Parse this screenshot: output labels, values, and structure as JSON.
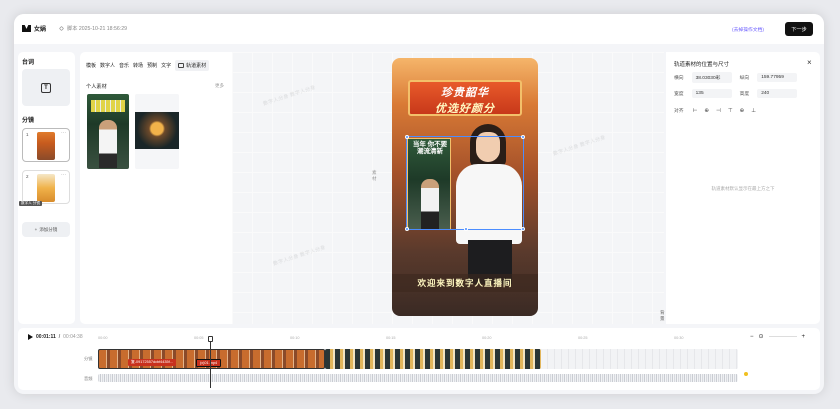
{
  "header": {
    "app_name": "女娲",
    "script_label": "脚本 2025-10-21 18:56:29",
    "help_link": "(去掉操作文档)",
    "next_button": "下一步"
  },
  "left_panel": {
    "title_lines": "台词",
    "title_scenes": "分镜",
    "text_icon_glyph": "T",
    "scenes": [
      {
        "num": "1",
        "more": "···"
      },
      {
        "num": "2",
        "more": "···",
        "tag": "数字人 分镜"
      }
    ],
    "add_scene": "添加分镜"
  },
  "materials": {
    "tabs": [
      "模板",
      "数字人",
      "音乐",
      "转场",
      "预制",
      "文字"
    ],
    "track_tab": "轨道素材",
    "personal_title": "个人素材",
    "more": "更多",
    "mat1_text": "当年 你不要"
  },
  "canvas": {
    "banner_line1": "珍贵韶华",
    "banner_line2": "优选好颜分",
    "inset_text": "当年 你不要 潮流清新",
    "caption": "欢迎来到数字人直播间",
    "bg_toggle": "背景",
    "side_label": "素材",
    "watermarks": [
      "数字人分身 数字人分身",
      "数字人分身 数字人分身",
      "数字人分身 数字人分身"
    ]
  },
  "properties": {
    "title": "轨道素材的位置与尺寸",
    "fields": {
      "x_label": "横向",
      "x_value": "38.03030彩",
      "y_label": "纵向",
      "y_value": "159.77959",
      "w_label": "宽度",
      "w_value": "135",
      "h_label": "高度",
      "h_value": "240",
      "align_label": "对齐"
    },
    "empty_text": "轨道素材默认显示在最上方之下"
  },
  "timeline": {
    "current_time": "00:01:11",
    "total_time": "00:04:38",
    "ruler_ticks": [
      "00:00",
      "00:05",
      "00:10",
      "00:15",
      "00:20",
      "00:25",
      "00:30",
      "00:35",
      "00:40"
    ],
    "track1_label": "分镜",
    "track2_label": "音频",
    "clip_label_a": "复-09172557dcbf4435f...",
    "clip_label_b": "(x)01.mp4",
    "zoom_minus": "−",
    "zoom_plus": "+"
  }
}
